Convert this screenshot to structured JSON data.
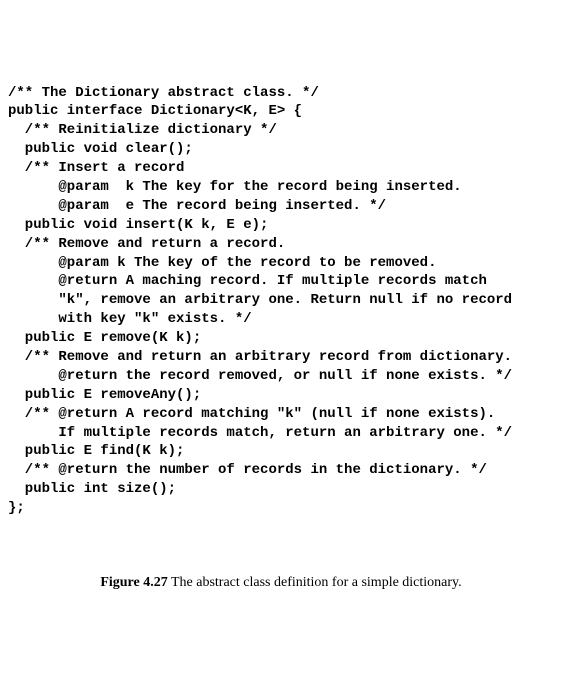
{
  "code": {
    "l01": "/** The Dictionary abstract class. */",
    "l02": "public interface Dictionary<K, E> {",
    "l03": "",
    "l04": "  /** Reinitialize dictionary */",
    "l05": "  public void clear();",
    "l06": "",
    "l07": "  /** Insert a record",
    "l08": "      @param  k The key for the record being inserted.",
    "l09": "      @param  e The record being inserted. */",
    "l10": "  public void insert(K k, E e);",
    "l11": "",
    "l12": "  /** Remove and return a record.",
    "l13": "      @param k The key of the record to be removed.",
    "l14": "      @return A maching record. If multiple records match",
    "l15": "      \"k\", remove an arbitrary one. Return null if no record",
    "l16": "      with key \"k\" exists. */",
    "l17": "  public E remove(K k);",
    "l18": "",
    "l19": "  /** Remove and return an arbitrary record from dictionary.",
    "l20": "      @return the record removed, or null if none exists. */",
    "l21": "  public E removeAny();",
    "l22": "",
    "l23": "  /** @return A record matching \"k\" (null if none exists).",
    "l24": "      If multiple records match, return an arbitrary one. */",
    "l25": "  public E find(K k);",
    "l26": "",
    "l27": "  /** @return the number of records in the dictionary. */",
    "l28": "  public int size();",
    "l29": "};"
  },
  "caption": {
    "label": "Figure 4.27",
    "text": " The abstract class definition for a simple dictionary."
  }
}
